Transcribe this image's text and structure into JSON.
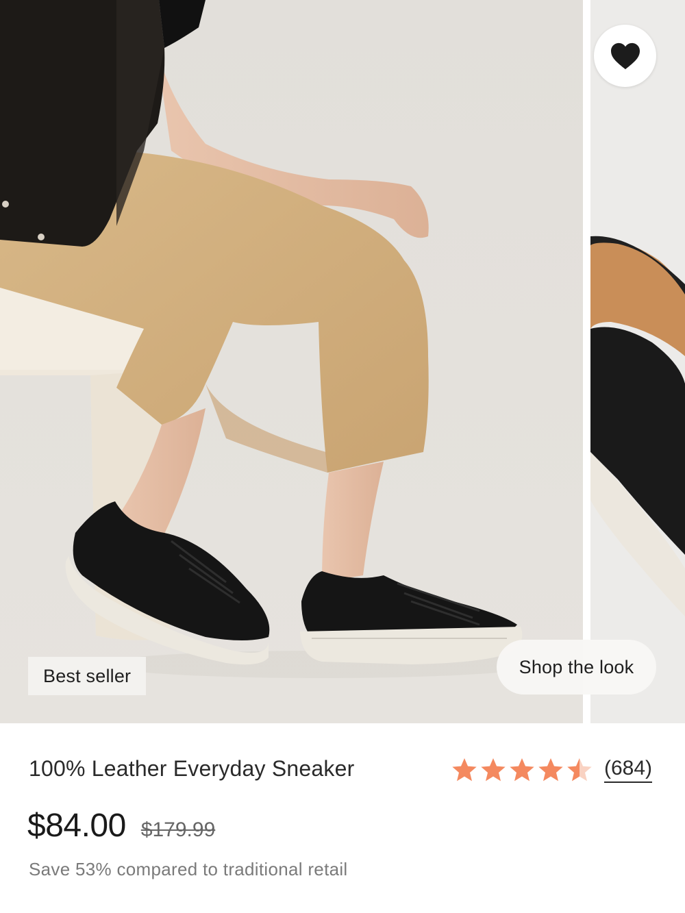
{
  "product": {
    "title": "100% Leather Everyday Sneaker",
    "price": "$84.00",
    "compare_price": "$179.99",
    "savings_text": "Save 53% compared to traditional retail",
    "rating": 4.5,
    "rating_max": 5,
    "review_count": "(684)"
  },
  "gallery": {
    "badge": "Best seller",
    "shop_look_label": "Shop the look",
    "wishlist_icon": "heart-icon",
    "slides": [
      "model-wearing-black-sneakers-photo",
      "black-sneaker-detail-photo"
    ]
  },
  "colors": {
    "star": "#f4895f",
    "background_photo": "#e4e1dc",
    "text": "#2a2a2a",
    "muted_text": "#7a7a7a"
  }
}
